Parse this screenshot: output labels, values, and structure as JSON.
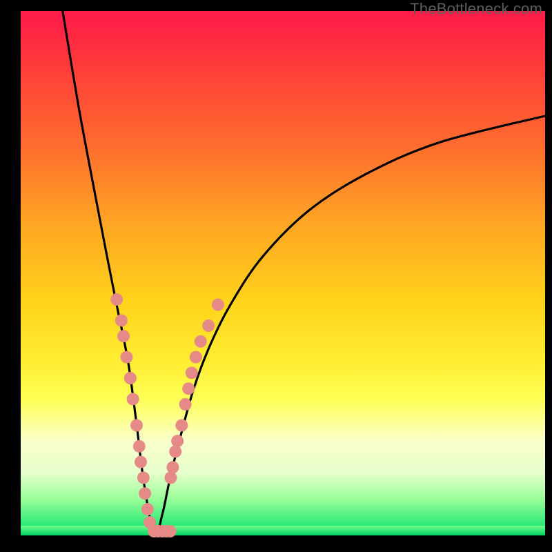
{
  "watermark": "TheBottleneck.com",
  "colors": {
    "gradient_top": "#ff1a4a",
    "gradient_bottom": "#00e06a",
    "curve": "#000000",
    "marker": "#e58a87",
    "frame": "#000000"
  },
  "chart_data": {
    "type": "line",
    "title": "",
    "xlabel": "",
    "ylabel": "",
    "xlim": [
      0,
      100
    ],
    "ylim": [
      0,
      100
    ],
    "grid": false,
    "background": "rainbow-gradient",
    "note": "V-shaped bottleneck curve; minimum ≈ x 25.5, y 0. Left branch rises steeply to y≈100 at x≈8; right branch rises more gradually to y≈80 at x=100.",
    "series": [
      {
        "name": "bottleneck-curve",
        "x": [
          8,
          11,
          14,
          16.5,
          18.5,
          20.5,
          22,
          23.5,
          25.5,
          27,
          28.5,
          30.5,
          33,
          36,
          40,
          46,
          55,
          66,
          80,
          100
        ],
        "values": [
          100,
          82,
          66,
          53,
          43,
          33,
          22,
          10,
          0,
          4,
          11,
          19,
          28,
          36,
          44,
          53,
          62,
          69,
          75,
          80
        ]
      }
    ],
    "markers": {
      "name": "highlighted-points",
      "note": "Salmon dots clustered near the valley on both branches and along the flat bottom.",
      "points": [
        {
          "x": 18.3,
          "y": 45
        },
        {
          "x": 19.2,
          "y": 41
        },
        {
          "x": 19.6,
          "y": 38
        },
        {
          "x": 20.2,
          "y": 34
        },
        {
          "x": 20.9,
          "y": 30
        },
        {
          "x": 21.4,
          "y": 26
        },
        {
          "x": 22.1,
          "y": 21
        },
        {
          "x": 22.6,
          "y": 17
        },
        {
          "x": 22.9,
          "y": 14
        },
        {
          "x": 23.4,
          "y": 11
        },
        {
          "x": 23.7,
          "y": 8
        },
        {
          "x": 24.2,
          "y": 5
        },
        {
          "x": 24.6,
          "y": 2.5
        },
        {
          "x": 25.4,
          "y": 0.8
        },
        {
          "x": 26.2,
          "y": 0.8
        },
        {
          "x": 27.0,
          "y": 0.8
        },
        {
          "x": 27.8,
          "y": 0.8
        },
        {
          "x": 28.5,
          "y": 0.8
        },
        {
          "x": 28.6,
          "y": 11
        },
        {
          "x": 29.0,
          "y": 13
        },
        {
          "x": 29.5,
          "y": 16
        },
        {
          "x": 29.9,
          "y": 18
        },
        {
          "x": 30.7,
          "y": 21
        },
        {
          "x": 31.4,
          "y": 25
        },
        {
          "x": 32.0,
          "y": 28
        },
        {
          "x": 32.6,
          "y": 31
        },
        {
          "x": 33.4,
          "y": 34
        },
        {
          "x": 34.3,
          "y": 37
        },
        {
          "x": 35.8,
          "y": 40
        },
        {
          "x": 37.6,
          "y": 44
        }
      ]
    }
  }
}
